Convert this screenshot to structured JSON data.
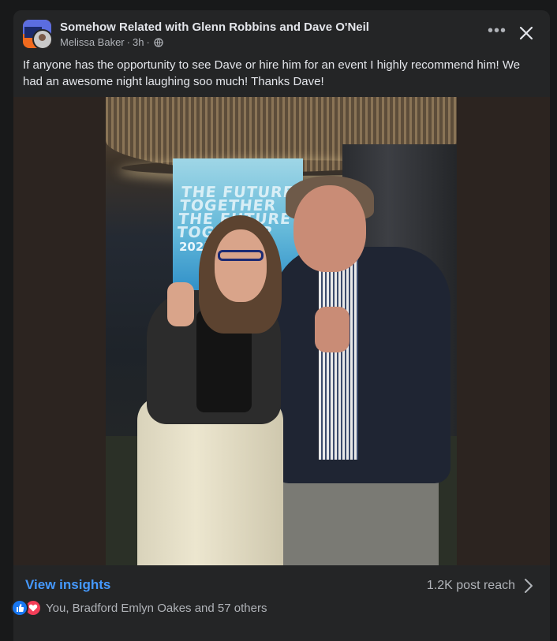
{
  "post": {
    "group_name": "Somehow Related with Glenn Robbins and Dave O'Neil",
    "author": "Melissa Baker",
    "time": "3h",
    "separator": "·",
    "text": "If anyone has the opportunity to see Dave or hire him for an event I highly recommend him! We had an awesome night laughing soo much! Thanks Dave!",
    "more_label": "•••",
    "visibility_icon": "globe-icon",
    "photo": {
      "screen_text": "THE FUTURE TOGETHER THE FUTURE TOGETHER",
      "screen_year": "2025"
    }
  },
  "footer": {
    "insights_label": "View insights",
    "reach_label": "1.2K post reach"
  },
  "reactions": {
    "icons": [
      "like-icon",
      "love-icon"
    ],
    "text": "You, Bradford Emlyn Oakes and 57 others"
  },
  "colors": {
    "background": "#18191a",
    "card": "#242526",
    "accent_link": "#4599ff",
    "primary_text": "#e4e6eb",
    "secondary_text": "#b0b3b8",
    "like": "#1877f2",
    "love": "#f33e58"
  }
}
